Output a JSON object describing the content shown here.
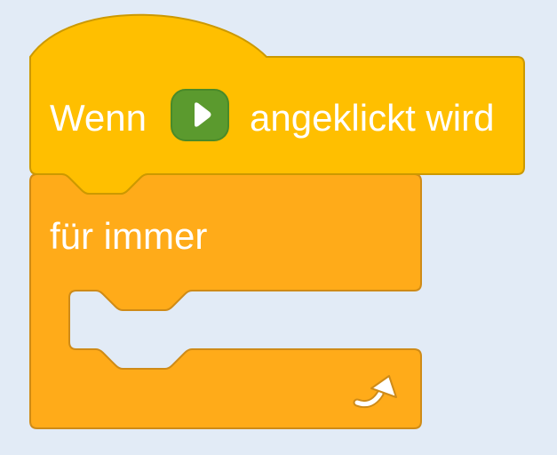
{
  "workspace": {
    "background": "#e2ebf6"
  },
  "hat_block": {
    "label_before": "Wenn",
    "icon": "green-flag-icon",
    "label_after": "angeklickt wird",
    "fill": "#ffbf00",
    "stroke": "#cc9900",
    "icon_fill": "#5b9a2e",
    "icon_stroke": "#4a8a28"
  },
  "forever_block": {
    "label": "für immer",
    "icon": "loop-arrow-icon",
    "fill": "#ffab19",
    "stroke": "#cf8b17"
  }
}
